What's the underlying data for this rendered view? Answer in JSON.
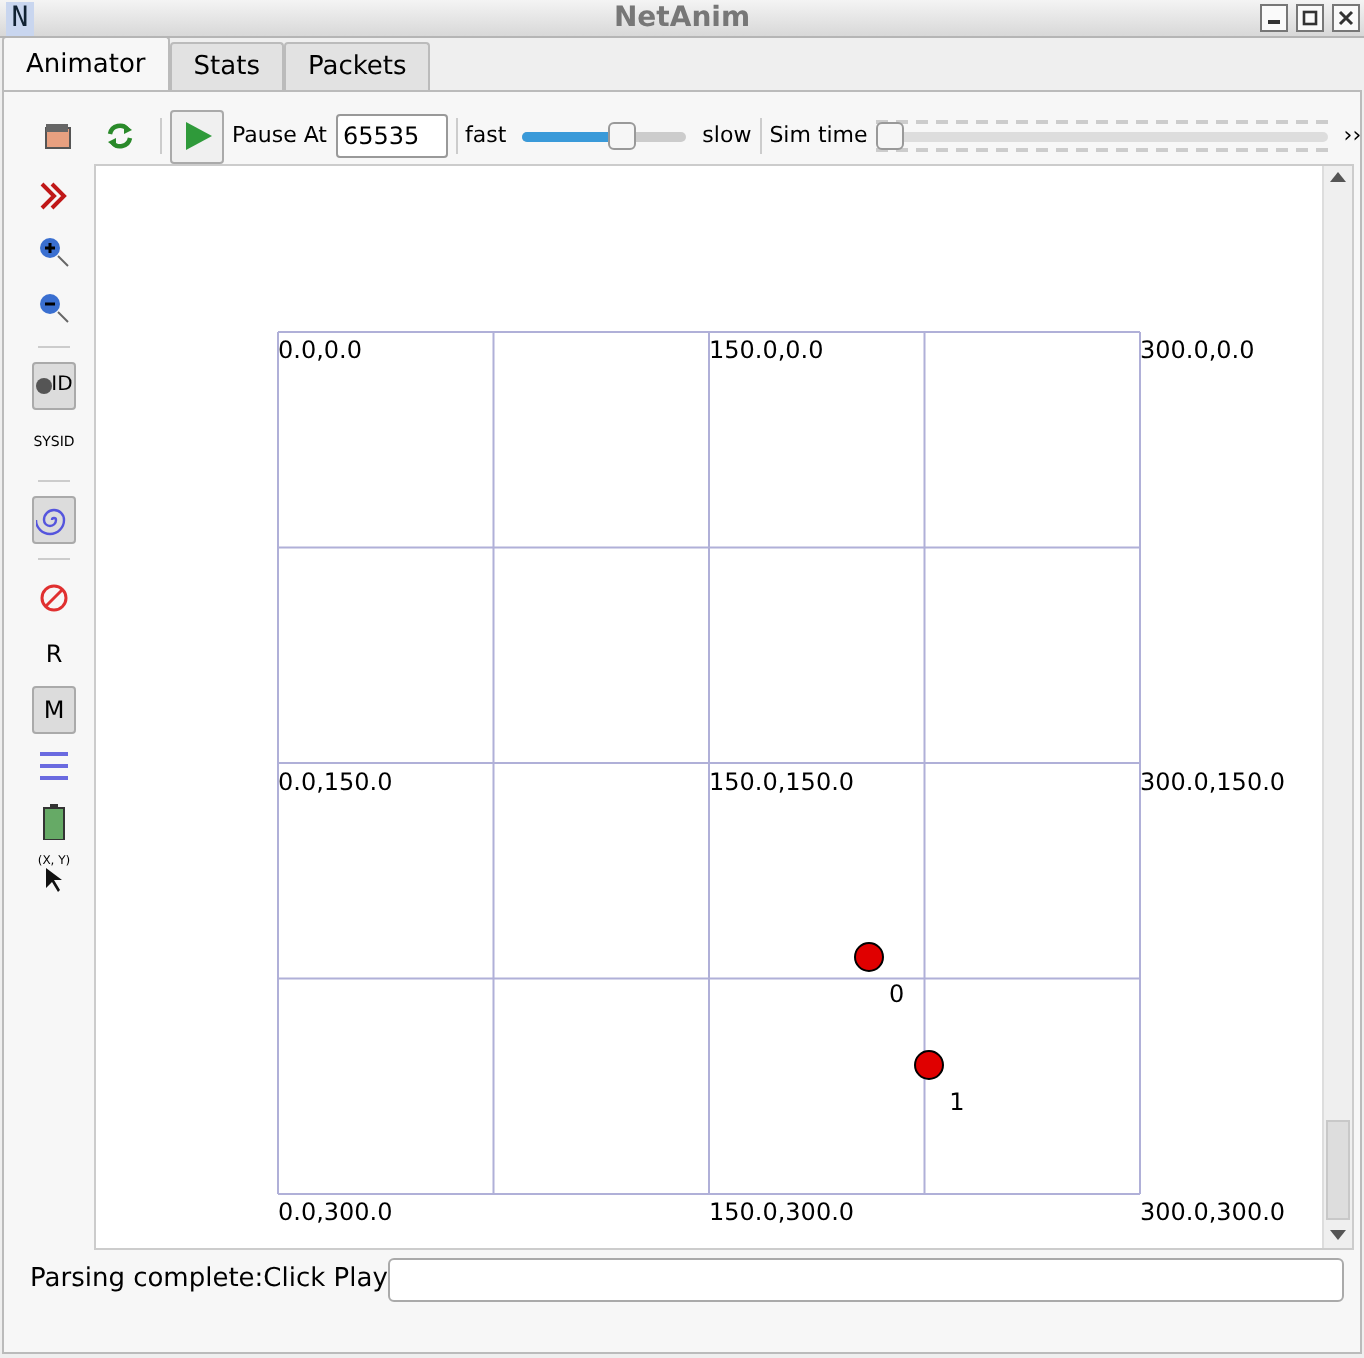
{
  "window": {
    "title": "NetAnim",
    "app_icon": "N"
  },
  "tabs": [
    {
      "label": "Animator",
      "selected": true
    },
    {
      "label": "Stats",
      "selected": false
    },
    {
      "label": "Packets",
      "selected": false
    }
  ],
  "toolbar": {
    "pause_label": "Pause At",
    "pause_value": "65535",
    "fast_label": "fast",
    "slow_label": "slow",
    "speed": {
      "level": 0.65
    },
    "sim_time_label": "Sim time",
    "sim_time": {
      "level": 0
    },
    "more": "››"
  },
  "side_tools": [
    {
      "kind": "chevrons",
      "pressed": false
    },
    {
      "kind": "zoom-in",
      "pressed": false
    },
    {
      "kind": "zoom-out",
      "pressed": false
    },
    {
      "kind": "sep"
    },
    {
      "kind": "node-id",
      "text": "ID",
      "pressed": true
    },
    {
      "kind": "sysid",
      "text": "SYSID",
      "pressed": false
    },
    {
      "kind": "sep"
    },
    {
      "kind": "spiral",
      "pressed": true
    },
    {
      "kind": "sep"
    },
    {
      "kind": "no",
      "pressed": false
    },
    {
      "kind": "letter",
      "text": "R",
      "pressed": false
    },
    {
      "kind": "letter",
      "text": "M",
      "pressed": true
    },
    {
      "kind": "lines",
      "pressed": false
    },
    {
      "kind": "battery",
      "pressed": false
    },
    {
      "kind": "xy",
      "text": "(X, Y)",
      "pressed": false
    }
  ],
  "canvas": {
    "grid_labels": [
      "0.0,0.0",
      "150.0,0.0",
      "300.0,0.0",
      "0.0,150.0",
      "150.0,150.0",
      "300.0,150.0",
      "0.0,300.0",
      "150.0,300.0",
      "300.0,300.0"
    ],
    "nodes": [
      {
        "label": "0",
        "color": "#e00000"
      },
      {
        "label": "1",
        "color": "#e00000"
      }
    ]
  },
  "status": {
    "message": "Parsing complete:Click Play"
  }
}
